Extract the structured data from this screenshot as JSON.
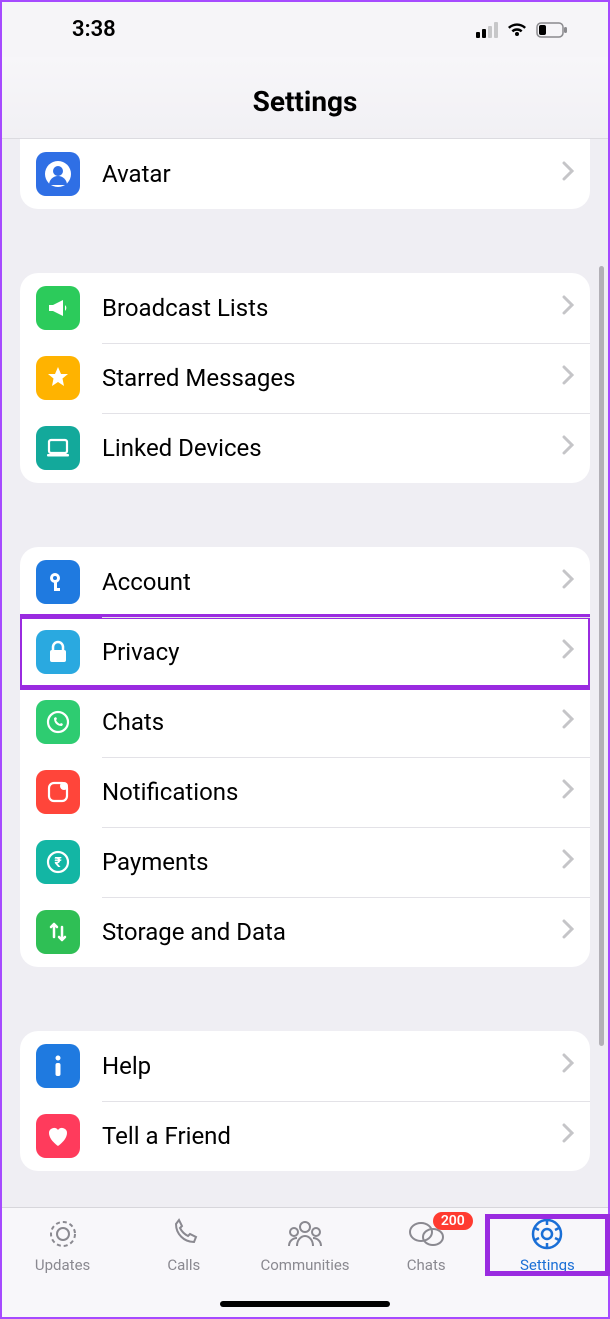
{
  "status": {
    "time": "3:38"
  },
  "header": {
    "title": "Settings"
  },
  "groups": [
    {
      "items": [
        {
          "key": "avatar",
          "label": "Avatar",
          "icon": "avatar-icon",
          "bg": "#2f6fe5"
        }
      ]
    },
    {
      "items": [
        {
          "key": "broadcast",
          "label": "Broadcast Lists",
          "icon": "megaphone-icon",
          "bg": "#2ccb5b"
        },
        {
          "key": "starred",
          "label": "Starred Messages",
          "icon": "star-icon",
          "bg": "#ffb300"
        },
        {
          "key": "linked",
          "label": "Linked Devices",
          "icon": "laptop-icon",
          "bg": "#13a99b"
        }
      ]
    },
    {
      "items": [
        {
          "key": "account",
          "label": "Account",
          "icon": "key-icon",
          "bg": "#1f7ae0"
        },
        {
          "key": "privacy",
          "label": "Privacy",
          "icon": "lock-icon",
          "bg": "#2aa9e0",
          "highlighted": true
        },
        {
          "key": "chats",
          "label": "Chats",
          "icon": "whatsapp-icon",
          "bg": "#2ecc71"
        },
        {
          "key": "notifications",
          "label": "Notifications",
          "icon": "notification-icon",
          "bg": "#ff453a"
        },
        {
          "key": "payments",
          "label": "Payments",
          "icon": "rupee-icon",
          "bg": "#13b6a4"
        },
        {
          "key": "storage",
          "label": "Storage and Data",
          "icon": "arrows-icon",
          "bg": "#2fbf55"
        }
      ]
    },
    {
      "items": [
        {
          "key": "help",
          "label": "Help",
          "icon": "info-icon",
          "bg": "#1f7ae0"
        },
        {
          "key": "tell",
          "label": "Tell a Friend",
          "icon": "heart-icon",
          "bg": "#ff3b5c"
        }
      ]
    }
  ],
  "tabs": [
    {
      "key": "updates",
      "label": "Updates",
      "icon": "updates-icon"
    },
    {
      "key": "calls",
      "label": "Calls",
      "icon": "calls-icon"
    },
    {
      "key": "communities",
      "label": "Communities",
      "icon": "communities-icon"
    },
    {
      "key": "chats-tab",
      "label": "Chats",
      "icon": "chats-icon",
      "badge": "200"
    },
    {
      "key": "settings-tab",
      "label": "Settings",
      "icon": "settings-icon",
      "active": true,
      "highlighted": true
    }
  ]
}
